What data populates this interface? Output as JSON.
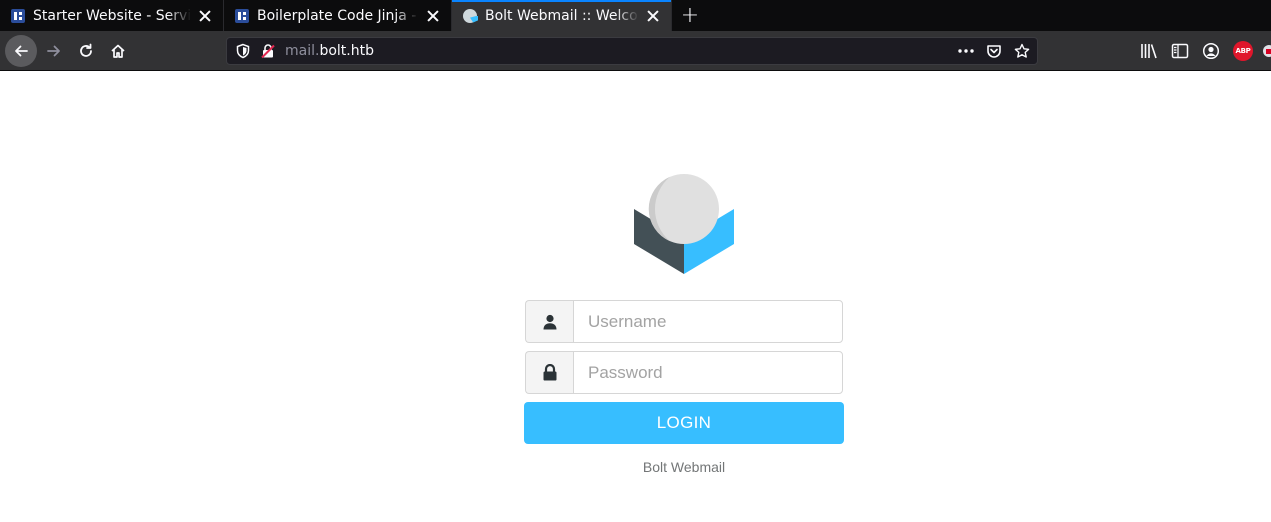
{
  "browser": {
    "tabs": [
      {
        "title": "Starter Website - Services",
        "favicon": "starter-site-favicon",
        "active": false
      },
      {
        "title": "Boilerplate Code Jinja - Server Side Template Injection",
        "favicon": "starter-site-favicon",
        "active": false
      },
      {
        "title": "Bolt Webmail :: Welcome to Bolt Webmail",
        "favicon": "roundcube-favicon",
        "active": true
      }
    ],
    "new_tab_label": "+",
    "url": {
      "subdomain": "mail.",
      "domain": "bolt.htb"
    },
    "extensions": {
      "abp_label": "ABP"
    }
  },
  "login": {
    "username_placeholder": "Username",
    "password_placeholder": "Password",
    "login_label": "LOGIN",
    "product_name": "Bolt Webmail"
  },
  "colors": {
    "accent": "#37beff",
    "logo_dark": "#435056",
    "logo_light_sphere": "#e0e0e0",
    "tab_bar": "#0c0c0d",
    "toolbar": "#323234",
    "active_tab_line": "#0a84ff",
    "abp_red": "#e0162b"
  }
}
